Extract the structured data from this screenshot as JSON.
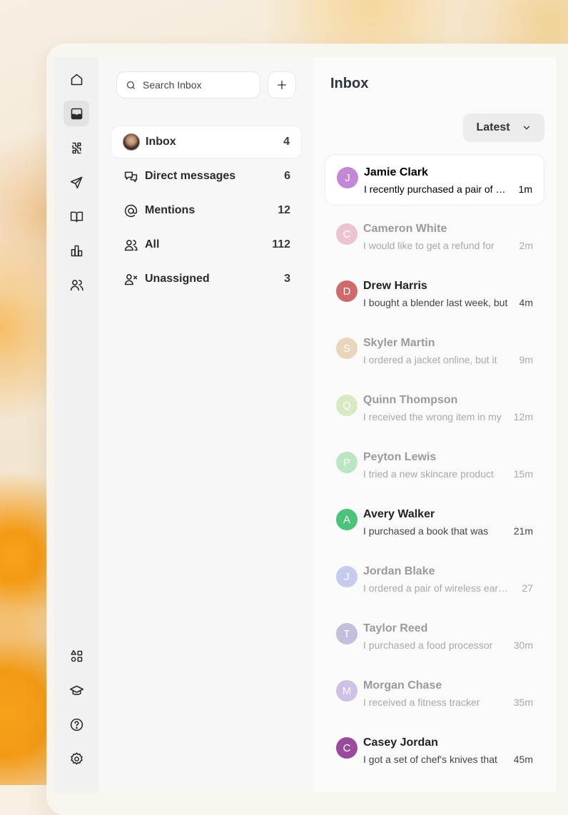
{
  "search": {
    "placeholder": "Search Inbox"
  },
  "nav": [
    {
      "label": "Inbox",
      "count": "4",
      "icon": "avatar-icon"
    },
    {
      "label": "Direct messages",
      "count": "6",
      "icon": "chat-bubbles-icon"
    },
    {
      "label": "Mentions",
      "count": "12",
      "icon": "at-sign-icon"
    },
    {
      "label": "All",
      "count": "112",
      "icon": "users-icon"
    },
    {
      "label": "Unassigned",
      "count": "3",
      "icon": "user-x-icon"
    }
  ],
  "main": {
    "title": "Inbox",
    "sort_label": "Latest"
  },
  "conversations": [
    {
      "initial": "J",
      "name": "Jamie Clark",
      "preview": "I recently purchased a pair of shoes",
      "time": "1m",
      "color": "#c387d8",
      "state": "selected"
    },
    {
      "initial": "C",
      "name": "Cameron White",
      "preview": "I would like to get  a refund for",
      "time": "2m",
      "color": "#dd8fa8",
      "state": "read"
    },
    {
      "initial": "D",
      "name": "Drew Harris",
      "preview": "I bought a blender last week, but",
      "time": "4m",
      "color": "#cf6a6a",
      "state": "unread"
    },
    {
      "initial": "S",
      "name": "Skyler Martin",
      "preview": "I ordered a jacket online, but it",
      "time": "9m",
      "color": "#d9b17f",
      "state": "read"
    },
    {
      "initial": "Q",
      "name": "Quinn Thompson",
      "preview": "I received the wrong item in my",
      "time": "12m",
      "color": "#b5dc8b",
      "state": "read"
    },
    {
      "initial": "P",
      "name": "Peyton Lewis",
      "preview": "I tried a new skincare product",
      "time": "15m",
      "color": "#7fd18b",
      "state": "read"
    },
    {
      "initial": "A",
      "name": "Avery Walker",
      "preview": "I purchased a book that was",
      "time": "21m",
      "color": "#4cc37a",
      "state": "unread"
    },
    {
      "initial": "J",
      "name": "Jordan Blake",
      "preview": "I ordered a pair of wireless earbuds",
      "time": "27",
      "color": "#8f9ee0",
      "state": "read"
    },
    {
      "initial": "T",
      "name": "Taylor Reed",
      "preview": "I purchased a food processor",
      "time": "30m",
      "color": "#8f84c2",
      "state": "read"
    },
    {
      "initial": "M",
      "name": "Morgan Chase",
      "preview": "I received a fitness tracker",
      "time": "35m",
      "color": "#a487d6",
      "state": "read"
    },
    {
      "initial": "C",
      "name": "Casey Jordan",
      "preview": "I got a set of chef's knives that",
      "time": "45m",
      "color": "#9a4a9a",
      "state": "unread"
    }
  ],
  "rail_icons": [
    "home-icon",
    "inbox-icon",
    "integrations-icon",
    "send-icon",
    "book-icon",
    "reports-icon",
    "team-icon",
    "apps-icon",
    "academy-icon",
    "help-icon",
    "settings-icon"
  ]
}
